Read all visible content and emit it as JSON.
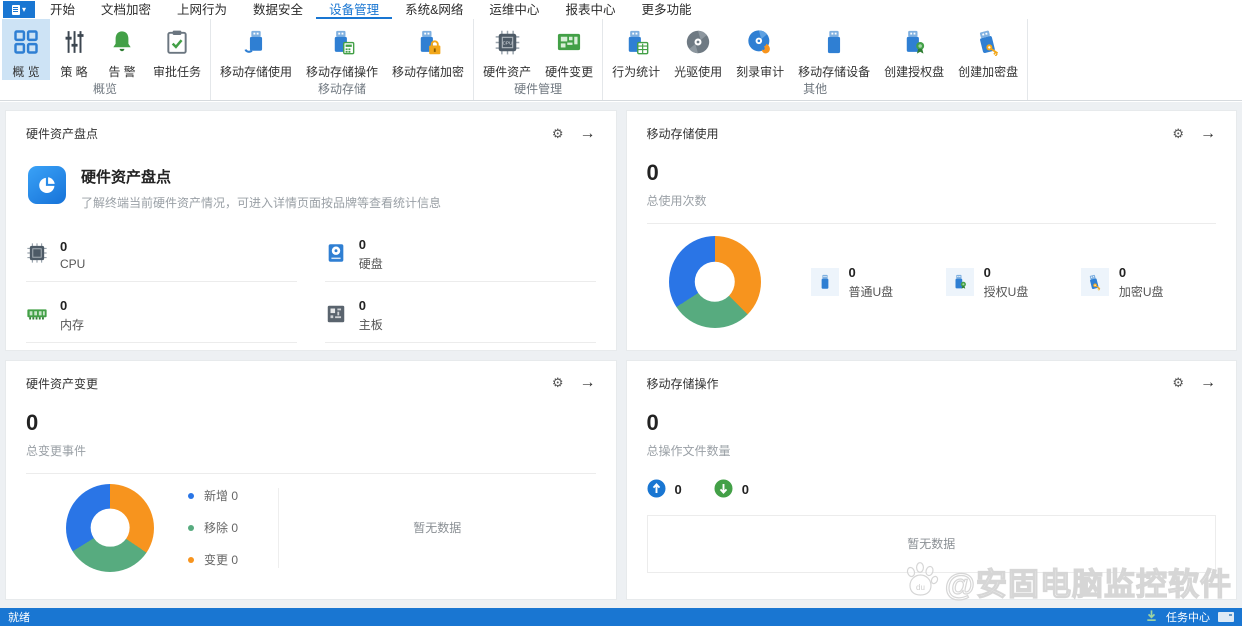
{
  "menu": {
    "items": [
      {
        "label": "开始"
      },
      {
        "label": "文档加密"
      },
      {
        "label": "上网行为"
      },
      {
        "label": "数据安全"
      },
      {
        "label": "设备管理",
        "active": true
      },
      {
        "label": "系统&网络"
      },
      {
        "label": "运维中心"
      },
      {
        "label": "报表中心"
      },
      {
        "label": "更多功能"
      }
    ]
  },
  "ribbon": {
    "groups": [
      {
        "label": "概览",
        "buttons": [
          {
            "label": "概 览",
            "active": true
          },
          {
            "label": "策 略"
          },
          {
            "label": "告 警"
          },
          {
            "label": "审批任务"
          }
        ]
      },
      {
        "label": "移动存储",
        "buttons": [
          {
            "label": "移动存储使用"
          },
          {
            "label": "移动存储操作"
          },
          {
            "label": "移动存储加密"
          }
        ]
      },
      {
        "label": "硬件管理",
        "buttons": [
          {
            "label": "硬件资产"
          },
          {
            "label": "硬件变更"
          }
        ]
      },
      {
        "label": "其他",
        "buttons": [
          {
            "label": "行为统计"
          },
          {
            "label": "光驱使用"
          },
          {
            "label": "刻录审计"
          },
          {
            "label": "移动存储设备"
          },
          {
            "label": "创建授权盘"
          },
          {
            "label": "创建加密盘"
          }
        ]
      }
    ]
  },
  "cards": {
    "inventory": {
      "title": "硬件资产盘点",
      "feature_title": "硬件资产盘点",
      "feature_desc": "了解终端当前硬件资产情况，可进入详情页面按品牌等查看统计信息",
      "stats": [
        {
          "value": "0",
          "label": "CPU"
        },
        {
          "value": "0",
          "label": "硬盘"
        },
        {
          "value": "0",
          "label": "内存"
        },
        {
          "value": "0",
          "label": "主板"
        }
      ]
    },
    "usage": {
      "title": "移动存储使用",
      "total": "0",
      "total_label": "总使用次数",
      "donut": [
        {
          "color": "#f7941e",
          "from": 0,
          "to": 135
        },
        {
          "color": "#57ab7f",
          "from": 135,
          "to": 237
        },
        {
          "color": "#2a75e6",
          "from": 237,
          "to": 360
        }
      ],
      "stats": [
        {
          "value": "0",
          "label": "普通U盘"
        },
        {
          "value": "0",
          "label": "授权U盘"
        },
        {
          "value": "0",
          "label": "加密U盘"
        }
      ]
    },
    "change": {
      "title": "硬件资产变更",
      "total": "0",
      "total_label": "总变更事件",
      "donut": [
        {
          "color": "#f7941e",
          "from": 0,
          "to": 124
        },
        {
          "color": "#57ab7f",
          "from": 124,
          "to": 238
        },
        {
          "color": "#2a75e6",
          "from": 238,
          "to": 360
        }
      ],
      "legend": [
        {
          "name": "新增",
          "value": "0",
          "color": "#2a75e6"
        },
        {
          "name": "移除",
          "value": "0",
          "color": "#57ab7f"
        },
        {
          "name": "变更",
          "value": "0",
          "color": "#f7941e"
        }
      ],
      "empty_text": "暂无数据"
    },
    "operation": {
      "title": "移动存储操作",
      "total": "0",
      "total_label": "总操作文件数量",
      "upload_count": "0",
      "download_count": "0",
      "empty_text": "暂无数据"
    }
  },
  "status_bar": {
    "ready": "就绪",
    "task_center": "任务中心"
  },
  "watermark": {
    "badge": "du",
    "text": "@安固电脑监控软件"
  },
  "colors": {
    "accent": "#1976d2",
    "donut_blue": "#2a75e6",
    "donut_orange": "#f7941e",
    "donut_green": "#57ab7f"
  }
}
